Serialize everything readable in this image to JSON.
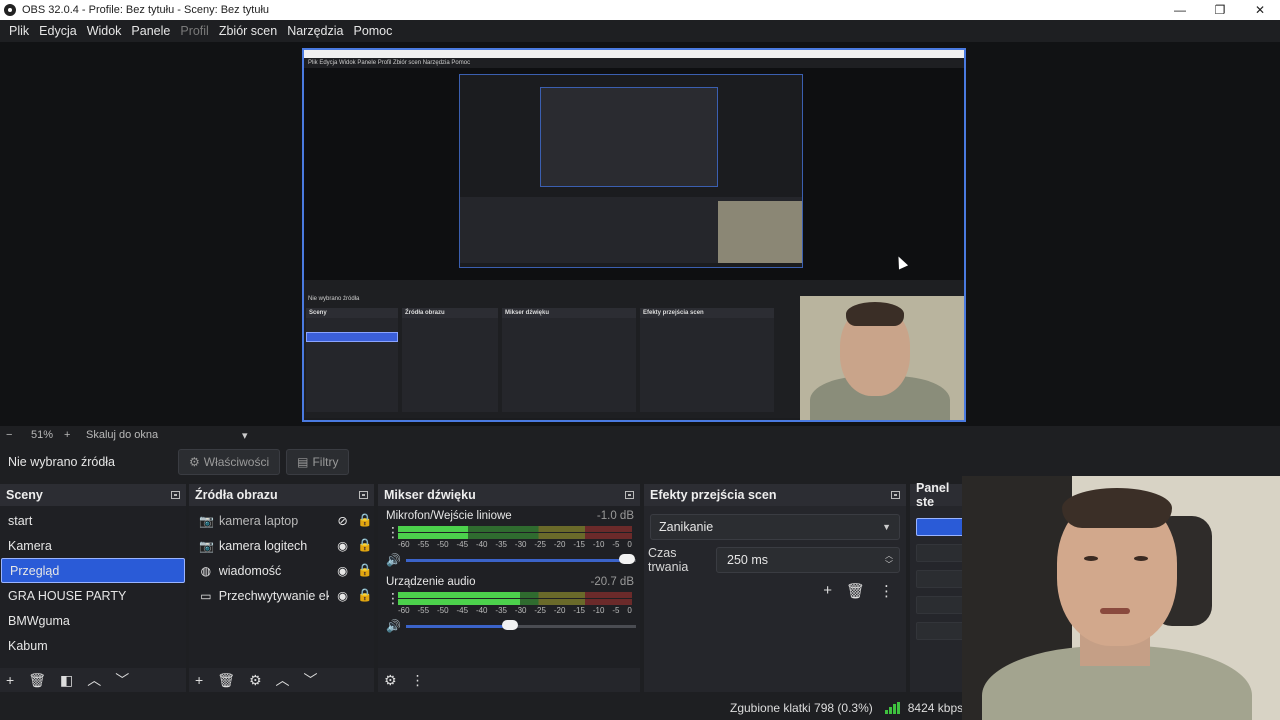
{
  "window": {
    "title": "OBS 32.0.4 - Profile: Bez tytułu - Sceny: Bez tytułu",
    "minimize": "—",
    "restore": "❐",
    "close": "✕"
  },
  "menu": {
    "items": [
      {
        "label": "Plik",
        "enabled": true
      },
      {
        "label": "Edycja",
        "enabled": true
      },
      {
        "label": "Widok",
        "enabled": true
      },
      {
        "label": "Panele",
        "enabled": true
      },
      {
        "label": "Profil",
        "enabled": false
      },
      {
        "label": "Zbiór scen",
        "enabled": true
      },
      {
        "label": "Narzędzia",
        "enabled": true
      },
      {
        "label": "Pomoc",
        "enabled": true
      }
    ]
  },
  "preview": {
    "nested_menu": "Plik   Edycja   Widok   Panele   Profil   Zbiór scen   Narzędzia   Pomoc",
    "nested_status": "Nie wybrano źródła"
  },
  "scale": {
    "minus": "−",
    "zoom": "51%",
    "plus": "+",
    "mode": "Skaluj do okna",
    "drop": "▾"
  },
  "source_toolbar": {
    "no_source": "Nie wybrano źródła",
    "properties": "Właściwości",
    "filters": "Filtry"
  },
  "scenes": {
    "title": "Sceny",
    "items": [
      {
        "label": "start",
        "selected": false
      },
      {
        "label": "Kamera",
        "selected": false
      },
      {
        "label": "Przegląd",
        "selected": true
      },
      {
        "label": "GRA HOUSE PARTY",
        "selected": false
      },
      {
        "label": "BMWguma",
        "selected": false
      },
      {
        "label": "Kabum",
        "selected": false
      }
    ]
  },
  "sources": {
    "title": "Źródła obrazu",
    "items": [
      {
        "label": "kamera laptop",
        "icon": "camera-icon",
        "visible": false
      },
      {
        "label": "kamera logitech",
        "icon": "camera-icon",
        "visible": true
      },
      {
        "label": "wiadomość",
        "icon": "globe-icon",
        "visible": true
      },
      {
        "label": "Przechwytywanie ekra",
        "icon": "monitor-icon",
        "visible": true
      }
    ]
  },
  "mixer": {
    "title": "Mikser dźwięku",
    "ticks": [
      "-60",
      "-55",
      "-50",
      "-45",
      "-40",
      "-35",
      "-30",
      "-25",
      "-20",
      "-15",
      "-10",
      "-5",
      "0"
    ],
    "channels": [
      {
        "name": "Mikrofon/Wejście liniowe",
        "db": "-1.0 dB",
        "level": 0.3,
        "volume": 0.96
      },
      {
        "name": "Urządzenie audio",
        "db": "-20.7 dB",
        "level": 0.52,
        "volume": 0.45
      }
    ]
  },
  "transitions": {
    "title": "Efekty przejścia scen",
    "selected": "Zanikanie",
    "duration_label": "Czas trwania",
    "duration_value": "250 ms"
  },
  "controls": {
    "title": "Panel ste"
  },
  "status": {
    "dropped": "Zgubione klatki 798 (0.3%)",
    "kbps": "8424 kbps"
  },
  "colors": {
    "accent": "#2a5bd7",
    "meter_green": "#4cd14c",
    "meter_yellow": "#6a6a2a",
    "meter_red": "#6b2a2a"
  }
}
